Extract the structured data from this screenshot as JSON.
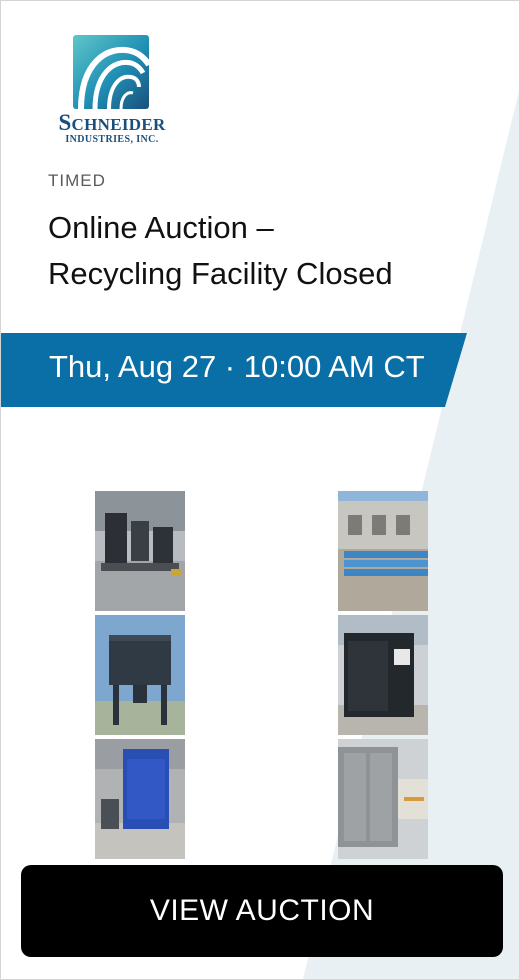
{
  "logo": {
    "name_initial": "S",
    "name_rest": "CHNEIDER",
    "subtitle": "INDUSTRIES, INC."
  },
  "auction": {
    "type": "TIMED",
    "title_line1": "Online Auction –",
    "title_line2": "Recycling Facility Closed",
    "date_time": "Thu, Aug 27 · 10:00 AM CT"
  },
  "photos": [
    {
      "name": "photo-industrial-machinery"
    },
    {
      "name": "photo-blue-steel-beams"
    },
    {
      "name": "photo-dust-collector"
    },
    {
      "name": "photo-generator-unit"
    },
    {
      "name": "photo-quincy-compressor"
    },
    {
      "name": "photo-metal-enclosure"
    }
  ],
  "cta": {
    "label": "VIEW AUCTION"
  },
  "colors": {
    "banner": "#0a6fa6",
    "diagonal_background": "#e9f0f4",
    "button": "#000000",
    "logo_text": "#1a4f7c"
  }
}
